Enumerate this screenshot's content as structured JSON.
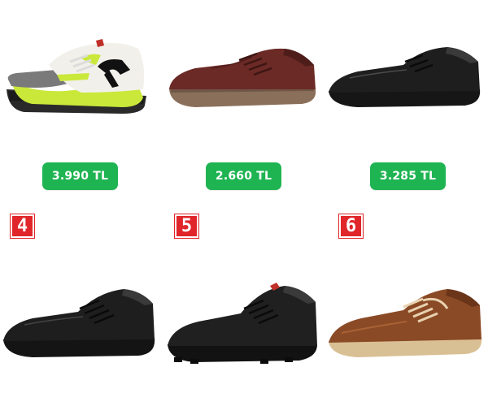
{
  "products": [
    {
      "name": "shoe-1",
      "color": "#c9e83a",
      "price": "3.990 TL",
      "price_color": "#1fb452"
    },
    {
      "name": "shoe-2",
      "color": "#6b2a26",
      "price": "2.660 TL",
      "price_color": "#1fb452"
    },
    {
      "name": "shoe-3",
      "color": "#1a1a1a",
      "price": "3.285 TL",
      "price_color": "#1fb452"
    },
    {
      "name": "shoe-4",
      "color": "#1a1a1a",
      "badge": "4"
    },
    {
      "name": "shoe-5",
      "color": "#1a1a1a",
      "badge": "5"
    },
    {
      "name": "shoe-6",
      "color": "#8a4a25",
      "badge": "6"
    }
  ],
  "badge_color": "#e0262a"
}
